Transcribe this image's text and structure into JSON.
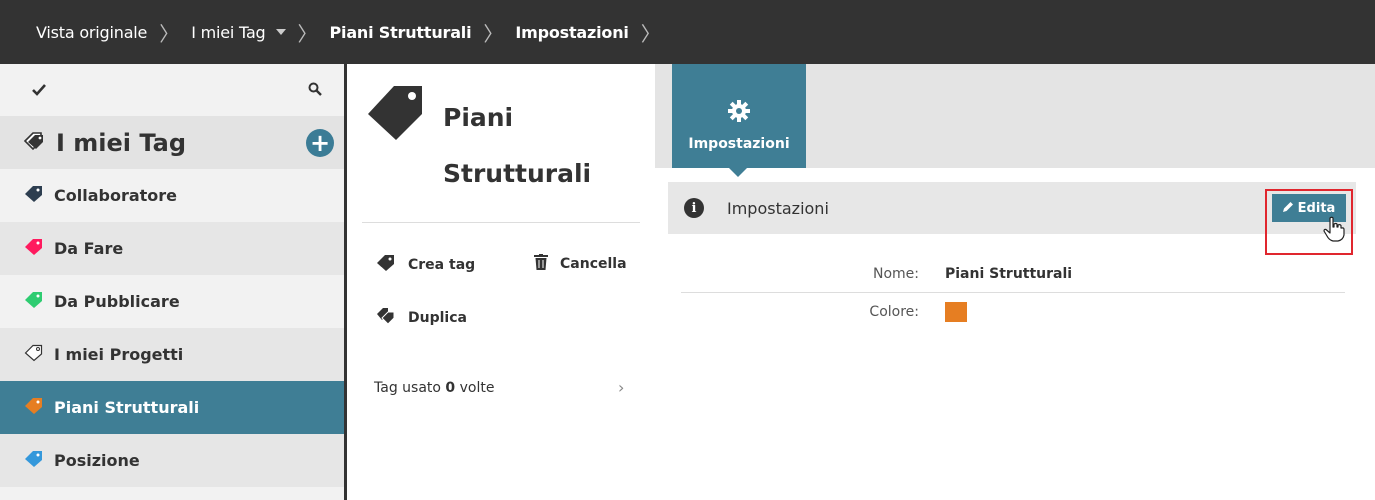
{
  "breadcrumb": {
    "items": [
      {
        "label": "Vista originale"
      },
      {
        "label": "I miei Tag"
      },
      {
        "label": "Piani Strutturali"
      },
      {
        "label": "Impostazioni"
      }
    ]
  },
  "sidebar": {
    "header_title": "I miei Tag",
    "items": [
      {
        "label": "Collaboratore",
        "color": "#2d3e50"
      },
      {
        "label": "Da Fare",
        "color": "#ff1a5e"
      },
      {
        "label": "Da Pubblicare",
        "color": "#2ecc71"
      },
      {
        "label": "I miei Progetti",
        "color": "#ffffff"
      },
      {
        "label": "Piani Strutturali",
        "color": "#e67e22"
      },
      {
        "label": "Posizione",
        "color": "#3498db"
      }
    ]
  },
  "detail": {
    "title_line1": "Piani",
    "title_line2": "Strutturali",
    "actions": {
      "create": "Crea tag",
      "delete": "Cancella",
      "duplicate": "Duplica"
    },
    "usage_prefix": "Tag usato",
    "usage_count": "0",
    "usage_suffix": "volte"
  },
  "settings": {
    "tab_label": "Impostazioni",
    "section_title": "Impostazioni",
    "edit_label": "Edita",
    "fields": {
      "name_label": "Nome:",
      "name_value": "Piani Strutturali",
      "color_label": "Colore:",
      "color_value": "#e67e22"
    }
  },
  "colors": {
    "accent": "#3f7e95",
    "topbar": "#333333",
    "highlight": "#e0262e"
  }
}
